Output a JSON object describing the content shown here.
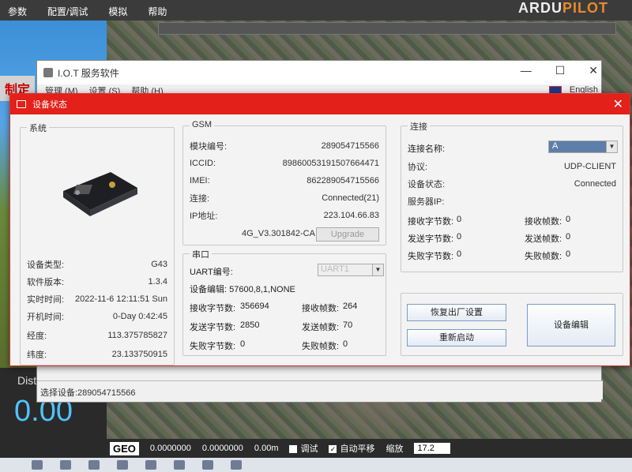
{
  "background": {
    "menu": [
      "参数",
      "配置/调试",
      "模拟",
      "帮助"
    ],
    "logo_left": "ARDU",
    "logo_right": "PILOT",
    "hud_badge": "制定",
    "dist_label": "Dist",
    "dist_value": "0.00",
    "status": {
      "geo": "GEO",
      "lat": "0.0000000",
      "lng": "0.0000000",
      "alt": "0.00m",
      "debug_label": "调试",
      "auto_pan_label": "自动平移",
      "zoom_label": "缩放",
      "zoom_value": "17.2"
    }
  },
  "iot_window": {
    "title": "I.O.T 服务软件",
    "menu": [
      "管理 (M)",
      "设置 (S)",
      "帮助 (H)"
    ],
    "lang": "English",
    "controls": [
      "—",
      "☐",
      "✕"
    ],
    "status_line": "选择设备:289054715566"
  },
  "dialog": {
    "title": "设备状态",
    "close": "✕",
    "system": {
      "title": "系统",
      "rows": [
        {
          "k": "设备类型:",
          "v": "G43"
        },
        {
          "k": "软件版本:",
          "v": "1.3.4"
        },
        {
          "k": "实时时间:",
          "v": "2022-11-6 12:11:51 Sun"
        },
        {
          "k": "开机时间:",
          "v": "0-Day 0:42:45"
        },
        {
          "k": "经度:",
          "v": "113.375785827"
        },
        {
          "k": "纬度:",
          "v": "23.133750915"
        }
      ]
    },
    "gsm": {
      "title": "GSM",
      "rows": [
        {
          "k": "模块编号:",
          "v": "289054715566"
        },
        {
          "k": "ICCID:",
          "v": "89860053191507664471"
        },
        {
          "k": "IMEI:",
          "v": "862289054715566"
        },
        {
          "k": "连接:",
          "v": "Connected(21)"
        },
        {
          "k": "IP地址:",
          "v": "223.104.66.83"
        }
      ],
      "version": "4G_V3.301842-CA",
      "upgrade_label": "Upgrade"
    },
    "serial": {
      "title": "串口",
      "uart_label": "UART编号:",
      "uart_value": "UART1",
      "params": "设备编辑: 57600,8,1,NONE",
      "rows": [
        {
          "k1": "接收字节数:",
          "v1": "356694",
          "k2": "接收帧数:",
          "v2": "264"
        },
        {
          "k1": "发送字节数:",
          "v1": "2850",
          "k2": "发送帧数:",
          "v2": "70"
        },
        {
          "k1": "失败字节数:",
          "v1": "0",
          "k2": "失败帧数:",
          "v2": "0"
        }
      ]
    },
    "connection": {
      "title": "连接",
      "name_label": "连接名称:",
      "name_value": "A",
      "rows": [
        {
          "k": "协议:",
          "v": "UDP-CLIENT"
        },
        {
          "k": "设备状态:",
          "v": "Connected"
        },
        {
          "k": "服务器IP:",
          "v": ""
        }
      ],
      "stats": [
        {
          "k1": "接收字节数:",
          "v1": "0",
          "k2": "接收帧数:",
          "v2": "0"
        },
        {
          "k1": "发送字节数:",
          "v1": "0",
          "k2": "发送帧数:",
          "v2": "0"
        },
        {
          "k1": "失败字节数:",
          "v1": "0",
          "k2": "失败帧数:",
          "v2": "0"
        }
      ]
    },
    "buttons": {
      "factory_reset": "恢复出厂设置",
      "restart": "重新启动",
      "edit": "设备编辑"
    }
  }
}
